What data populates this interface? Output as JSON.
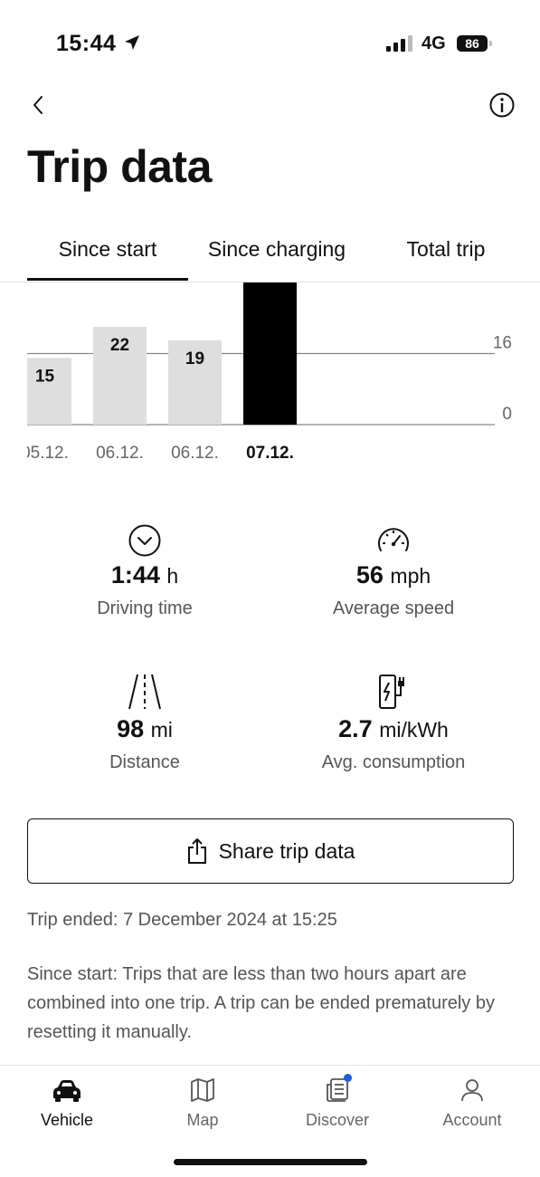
{
  "status_bar": {
    "time": "15:44",
    "network": "4G",
    "battery": "86"
  },
  "header": {
    "title": "Trip data"
  },
  "tabs": [
    {
      "label": "Since start",
      "active": true
    },
    {
      "label": "Since charging",
      "active": false
    },
    {
      "label": "Total trip",
      "active": false
    }
  ],
  "chart_data": {
    "type": "bar",
    "categories": [
      "05.12.",
      "06.12.",
      "06.12.",
      "07.12."
    ],
    "category_display": [
      "05.12.",
      "06.12.",
      "06.12.",
      "07.12."
    ],
    "values": [
      15,
      22,
      19,
      32
    ],
    "value_labels": [
      "15",
      "22",
      "19",
      ""
    ],
    "selected_index": 3,
    "yticks": [
      0,
      16
    ],
    "ylim": [
      0,
      32
    ],
    "colors": {
      "bar": "#dedede",
      "selected": "#000000",
      "axis": "#888888"
    }
  },
  "stats": {
    "driving_time": {
      "value": "1:44",
      "unit": "h",
      "label": "Driving time"
    },
    "average_speed": {
      "value": "56",
      "unit": "mph",
      "label": "Average speed"
    },
    "distance": {
      "value": "98",
      "unit": "mi",
      "label": "Distance"
    },
    "avg_consumption": {
      "value": "2.7",
      "unit": "mi/kWh",
      "label": "Avg. consumption"
    }
  },
  "share": {
    "label": "Share trip data"
  },
  "trip_ended": "Trip ended: 7 December 2024 at 15:25",
  "note": "Since start: Trips that are less than two hours apart are combined into one trip. A trip can be ended prematurely by resetting it manually.",
  "bottom_nav": [
    {
      "label": "Vehicle",
      "icon": "car-icon",
      "active": true
    },
    {
      "label": "Map",
      "icon": "map-icon",
      "active": false
    },
    {
      "label": "Discover",
      "icon": "discover-icon",
      "active": false,
      "badge": true
    },
    {
      "label": "Account",
      "icon": "account-icon",
      "active": false
    }
  ]
}
